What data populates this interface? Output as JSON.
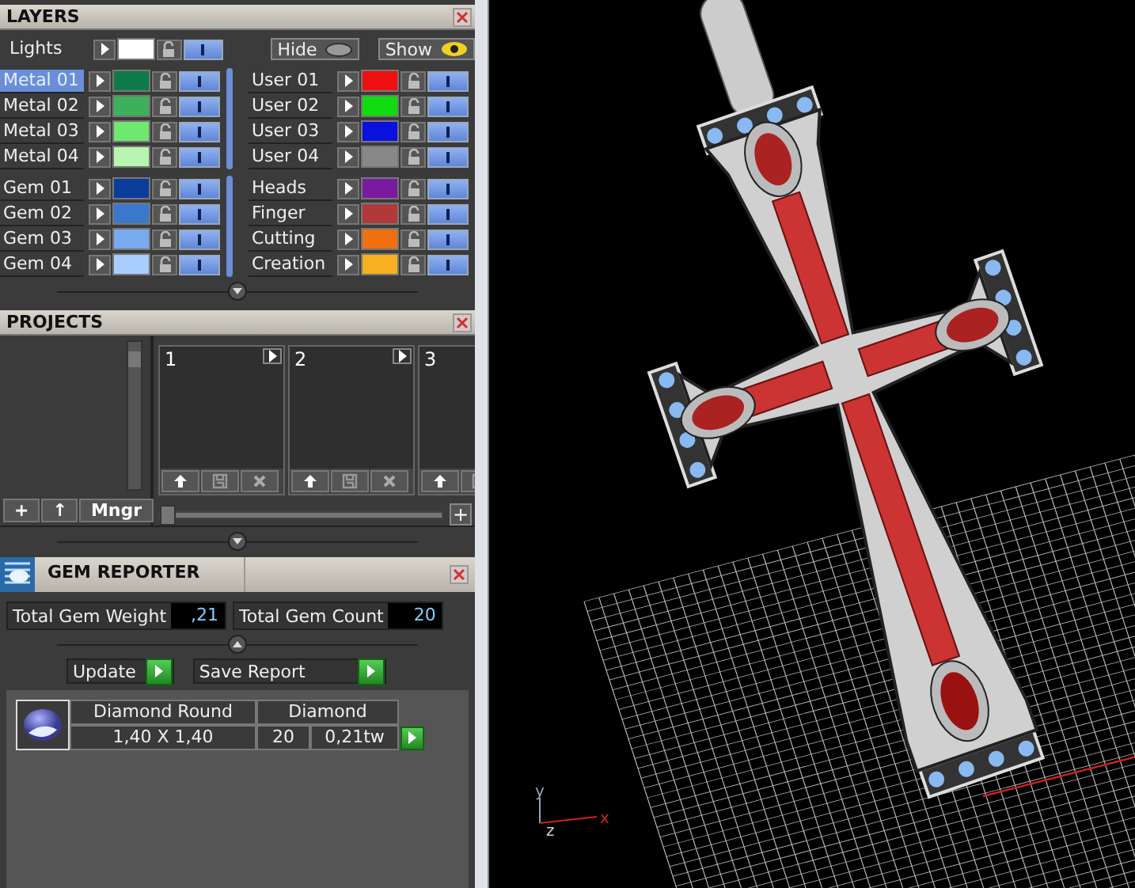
{
  "layers": {
    "title": "LAYERS",
    "lights": {
      "label": "Lights",
      "color": "#ffffff",
      "visible": true
    },
    "hide_button": "Hide",
    "show_button": "Show",
    "blocks": [
      {
        "left": [
          {
            "label": "Metal 01",
            "color": "#0e7a4a",
            "selected": true,
            "visible": true
          },
          {
            "label": "Metal 02",
            "color": "#3cb05a",
            "selected": false,
            "visible": true
          },
          {
            "label": "Metal 03",
            "color": "#6ee86e",
            "selected": false,
            "visible": true
          },
          {
            "label": "Metal 04",
            "color": "#b8f5b0",
            "selected": false,
            "visible": true
          }
        ],
        "right": [
          {
            "label": "User 01",
            "color": "#ee1010",
            "selected": false,
            "visible": true
          },
          {
            "label": "User 02",
            "color": "#10dd10",
            "selected": false,
            "visible": true
          },
          {
            "label": "User 03",
            "color": "#0a10dd",
            "selected": false,
            "visible": true
          },
          {
            "label": "User 04",
            "color": "#888888",
            "selected": false,
            "visible": true
          }
        ]
      },
      {
        "left": [
          {
            "label": "Gem 01",
            "color": "#0a3c9c",
            "selected": false,
            "visible": true
          },
          {
            "label": "Gem 02",
            "color": "#3a78cc",
            "selected": false,
            "visible": true
          },
          {
            "label": "Gem 03",
            "color": "#78aaf0",
            "selected": false,
            "visible": true
          },
          {
            "label": "Gem 04",
            "color": "#a8ccff",
            "selected": false,
            "visible": true
          }
        ],
        "right": [
          {
            "label": "Heads",
            "color": "#7a1aa0",
            "selected": false,
            "visible": true
          },
          {
            "label": "Finger",
            "color": "#b03a3a",
            "selected": false,
            "visible": true
          },
          {
            "label": "Cutting",
            "color": "#f07010",
            "selected": false,
            "visible": true
          },
          {
            "label": "Creation",
            "color": "#f8b020",
            "selected": false,
            "visible": true
          }
        ]
      }
    ]
  },
  "projects": {
    "title": "PROJECTS",
    "cards": [
      {
        "number": "1"
      },
      {
        "number": "2"
      },
      {
        "number": "3",
        "clipped": true
      }
    ],
    "buttons": [
      "+",
      "↑",
      "Mngr"
    ],
    "zoom": {
      "level": 0
    },
    "zoom_button": "+"
  },
  "gem_reporter": {
    "title": "GEM REPORTER",
    "total_weight": {
      "label": "Total Gem Weight",
      "value": ",21"
    },
    "total_count": {
      "label": "Total Gem Count",
      "value": "20"
    },
    "actions": [
      "Update",
      "Save Report"
    ],
    "gems": [
      {
        "shape": "Diamond Round",
        "material": "Diamond",
        "size": "1,40 X 1,40",
        "count": "20",
        "weight": "0,21tw"
      }
    ]
  },
  "viewport": {
    "axis_labels": {
      "y": "y",
      "z": "z",
      "x": "x"
    }
  }
}
